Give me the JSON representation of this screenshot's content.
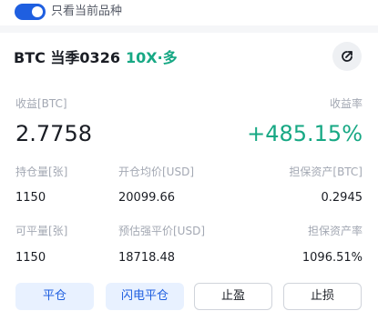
{
  "filter": {
    "label": "只看当前品种",
    "enabled": true
  },
  "position": {
    "symbol": "BTC 当季0326",
    "leverage": "10X·多",
    "pnl_label": "收益[BTC]",
    "pnl_value": "2.7758",
    "rate_label": "收益率",
    "rate_value": "+485.15%",
    "hold_label": "持仓量[张]",
    "hold_value": "1150",
    "open_avg_label": "开仓均价[USD]",
    "open_avg_value": "20099.66",
    "margin_label": "担保资产[BTC]",
    "margin_value": "0.2945",
    "closable_label": "可平量[张]",
    "closable_value": "1150",
    "liq_label": "预估强平价[USD]",
    "liq_value": "18718.48",
    "margin_rate_label": "担保资产率",
    "margin_rate_value": "1096.51%"
  },
  "actions": {
    "close": "平仓",
    "flash_close": "闪电平仓",
    "take_profit": "止盈",
    "stop_loss": "止损"
  },
  "colors": {
    "accent": "#1f5fe0",
    "profit": "#17a884"
  },
  "icons": {
    "share": "share-icon"
  }
}
